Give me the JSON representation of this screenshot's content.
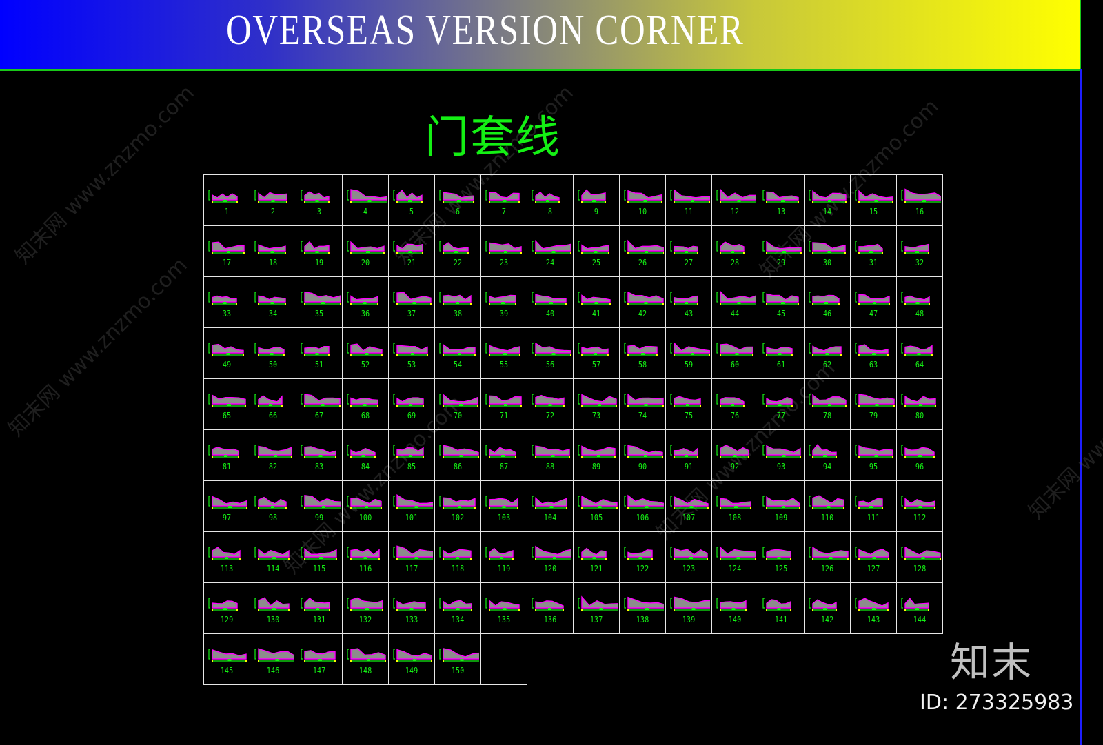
{
  "banner": {
    "title": "OVERSEAS VERSION CORNER",
    "gradient_colors": [
      "#0000ff",
      "#808080",
      "#ffff00"
    ]
  },
  "section_title": "门套线",
  "grid": {
    "columns": 16,
    "total_items": 150,
    "item_label_color": "#14f014",
    "profile_outline_color": "#ff00ff",
    "profile_fill_color": "#8c8c8c",
    "dimension_color": "#14f014",
    "dimension_tick_color": "#ffff00",
    "border_color": "#e6e6e6",
    "items": []
  },
  "watermark": {
    "text": "知末网 www.znzmo.com"
  },
  "brand": {
    "logo": "知末",
    "id_text": "ID: 273325983"
  }
}
